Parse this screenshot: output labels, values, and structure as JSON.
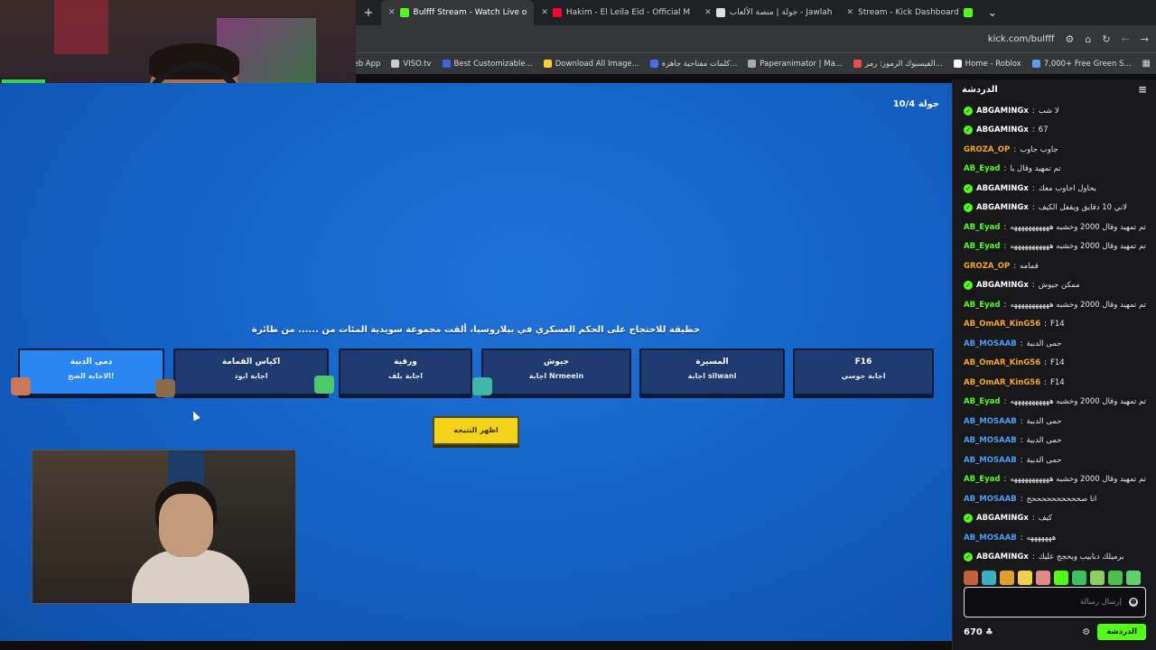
{
  "browser": {
    "tabs": [
      {
        "label": "Bulfff Stream - Watch Live o",
        "active": true,
        "favicon": "kick",
        "color": "#53fc18"
      },
      {
        "label": "Hakim - El Leila Eid - Official M",
        "active": false,
        "favicon": "youtube",
        "color": "#ff0033"
      },
      {
        "label": "جولة | منصة الألعاب - Jawlah",
        "active": false,
        "favicon": "jawlah",
        "color": "#dddddd"
      },
      {
        "label": "Stream - Kick Dashboard",
        "active": false,
        "favicon": "kick",
        "color": "#53fc18"
      }
    ],
    "url": "kick.com/bulfff",
    "bookmarks": [
      {
        "label": "Home - Roblox",
        "color": "#ffffff"
      },
      {
        "label": "7,000+ Free Green S...",
        "color": "#5a9cf0"
      },
      {
        "label": "الفيسبوك الرموز: رمز...",
        "color": "#e84d4d"
      },
      {
        "label": "Paperanimator | Ma...",
        "color": "#aaaaaa"
      },
      {
        "label": "كلمات مفتاحية جاهزة...",
        "color": "#4a6cf7"
      },
      {
        "label": "Download All Image...",
        "color": "#ffcc33"
      },
      {
        "label": "Best Customizable...",
        "color": "#3a66e0"
      },
      {
        "label": "VISO.tv",
        "color": "#cccccc"
      },
      {
        "label": "Pikzels - Web App",
        "color": "#53fc18"
      }
    ]
  },
  "game": {
    "round": "جولة 10/4",
    "question": "خطيقة للاحتجاج على الحكم العسكري في بيلاروسيا، ألقت مجموعة سويدية المئات من ...... من طائرة",
    "answers": [
      {
        "title": "دمى الدببة",
        "sub": "الاجابة الصح!",
        "selected": true
      },
      {
        "title": "اكياس القمامة",
        "sub": "اجابة ابود",
        "selected": false
      },
      {
        "title": "ورقية",
        "sub": "اجابة بلف",
        "selected": false
      },
      {
        "title": "جيوش",
        "sub": "اجابة Nrmeein",
        "selected": false
      },
      {
        "title": "المسيرة",
        "sub": "اجابة silwani",
        "selected": false
      },
      {
        "title": "F16",
        "sub": "اجابة جوسي",
        "selected": false
      }
    ],
    "result_button": "اظهر النتيجة"
  },
  "chat": {
    "title": "الدردشة",
    "messages": [
      {
        "user": "ABGAMINGx",
        "text": "لا شب",
        "color": "#ffffff",
        "badge": true
      },
      {
        "user": "ABGAMINGx",
        "text": "67",
        "color": "#ffffff",
        "badge": true
      },
      {
        "user": "GROZA_OP",
        "text": "جاوب جاوب",
        "color": "#f5a623",
        "badge": false
      },
      {
        "user": "AB_Eyad",
        "text": "تم تمهيد وقال يا",
        "color": "#53fc18",
        "badge": false
      },
      {
        "user": "ABGAMINGx",
        "text": "بحاول اجاوب معك",
        "color": "#ffffff",
        "badge": true
      },
      {
        "user": "ABGAMINGx",
        "text": "لاني 10 دقايق ويقفل الكيف",
        "color": "#ffffff",
        "badge": true
      },
      {
        "user": "AB_Eyad",
        "text": "تم تمهيد وقال 2000 وخشبه هههههههههههه",
        "color": "#53fc18",
        "badge": false
      },
      {
        "user": "AB_Eyad",
        "text": "تم تمهيد وقال 2000 وخشبه هههههههههههه",
        "color": "#53fc18",
        "badge": false
      },
      {
        "user": "GROZA_OP",
        "text": "قمامه",
        "color": "#f5a623",
        "badge": false
      },
      {
        "user": "ABGAMINGx",
        "text": "ممكن جيوش",
        "color": "#ffffff",
        "badge": true
      },
      {
        "user": "AB_Eyad",
        "text": "تم تمهيد وقال 2000 وخشبه هههههههههههه",
        "color": "#53fc18",
        "badge": false
      },
      {
        "user": "AB_OmAR_KinG56",
        "text": "F14",
        "color": "#f5a623",
        "badge": false
      },
      {
        "user": "AB_MOSAAB",
        "text": "حمى الدببة",
        "color": "#4a9df8",
        "badge": false
      },
      {
        "user": "AB_OmAR_KinG56",
        "text": "F14",
        "color": "#f5a623",
        "badge": false
      },
      {
        "user": "AB_OmAR_KinG56",
        "text": "F14",
        "color": "#f5a623",
        "badge": false
      },
      {
        "user": "AB_Eyad",
        "text": "تم تمهيد وقال 2000 وخشبه هههههههههههه",
        "color": "#53fc18",
        "badge": false
      },
      {
        "user": "AB_MOSAAB",
        "text": "حمى الدببة",
        "color": "#4a9df8",
        "badge": false
      },
      {
        "user": "AB_MOSAAB",
        "text": "حمى الدببة",
        "color": "#4a9df8",
        "badge": false
      },
      {
        "user": "AB_MOSAAB",
        "text": "حمى الدببة",
        "color": "#4a9df8",
        "badge": false
      },
      {
        "user": "AB_Eyad",
        "text": "تم تمهيد وقال 2000 وخشبه هههههههههههه",
        "color": "#53fc18",
        "badge": false
      },
      {
        "user": "AB_MOSAAB",
        "text": "انا صححححححححححح",
        "color": "#4a9df8",
        "badge": false
      },
      {
        "user": "ABGAMINGx",
        "text": "كيف",
        "color": "#ffffff",
        "badge": true
      },
      {
        "user": "AB_MOSAAB",
        "text": "هههههههه",
        "color": "#4a9df8",
        "badge": false
      },
      {
        "user": "ABGAMINGx",
        "text": "برميلك دبابيب ويحجج عليك",
        "color": "#ffffff",
        "badge": true
      }
    ],
    "input_placeholder": "إرسال رسالة",
    "viewer_count": "670",
    "send_label": "الدردشة"
  },
  "colors": {
    "accent": "#53fc18",
    "game_bg": "#1360c4",
    "selected_answer": "#2a86f2",
    "result_button": "#f4d41a"
  }
}
